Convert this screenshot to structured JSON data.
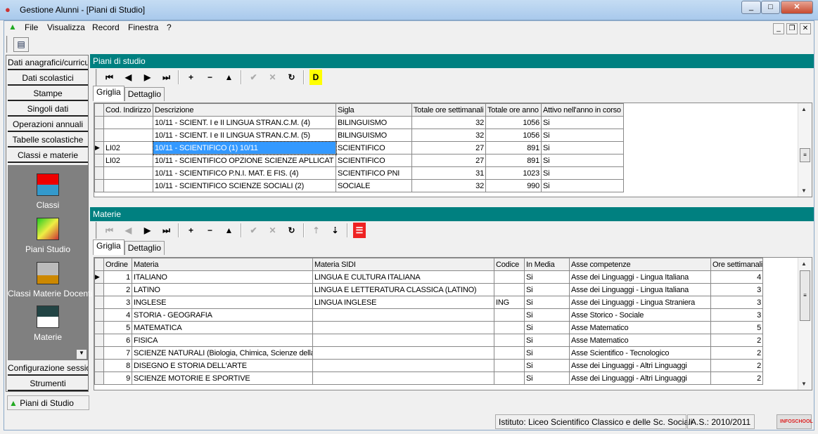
{
  "window": {
    "title": "Gestione Alunni - [Piani di Studio]",
    "controls": [
      "_",
      "□",
      "✕"
    ]
  },
  "menu": [
    "File",
    "Visualizza",
    "Record",
    "Finestra",
    "?"
  ],
  "sidebar": {
    "buttons_top": [
      "Dati anagrafici/curriculum",
      "Dati scolastici",
      "Stampe",
      "Singoli dati",
      "Operazioni annuali",
      "Tabelle scolastiche",
      "Classi e materie"
    ],
    "items": [
      {
        "label": "Classi",
        "icon": "classi-icon"
      },
      {
        "label": "Piani Studio",
        "icon": "piani-studio-icon"
      },
      {
        "label": "Classi Materie Docenti",
        "icon": "teacher-icon"
      },
      {
        "label": "Materie",
        "icon": "materie-icon"
      }
    ],
    "buttons_bottom": [
      "Configurazione sessione",
      "Strumenti"
    ],
    "active_window": "Piani di Studio"
  },
  "panel1": {
    "title": "Piani di studio",
    "tabs": [
      "Griglia",
      "Dettaglio"
    ],
    "columns": [
      "Cod. Indirizzo",
      "Descrizione",
      "Sigla",
      "Totale ore settimanali",
      "Totale ore anno",
      "Attivo nell'anno in corso"
    ],
    "rows": [
      [
        "",
        "10/11 - SCIENT. I e II LINGUA STRAN.C.M. (4)",
        "BILINGUISMO",
        "32",
        "1056",
        "Si"
      ],
      [
        "",
        "10/11 - SCIENT. I e II LINGUA STRAN.C.M. (5)",
        "BILINGUISMO",
        "32",
        "1056",
        "Si"
      ],
      [
        "LI02",
        "10/11 - SCIENTIFICO (1)  10/11",
        "SCIENTIFICO",
        "27",
        "891",
        "Si"
      ],
      [
        "LI02",
        "10/11 - SCIENTIFICO OPZIONE SCIENZE APLLICAT",
        "SCIENTIFICO",
        "27",
        "891",
        "Si"
      ],
      [
        "",
        "10/11 - SCIENTIFICO P.N.I. MAT. E FIS. (4)",
        "SCIENTIFICO PNI",
        "31",
        "1023",
        "Si"
      ],
      [
        "",
        "10/11 - SCIENTIFICO SCIENZE SOCIALI (2)",
        "SOCIALE",
        "32",
        "990",
        "Si"
      ]
    ],
    "current_row": 2
  },
  "panel2": {
    "title": "Materie",
    "tabs": [
      "Griglia",
      "Dettaglio"
    ],
    "columns": [
      "Ordine",
      "Materia",
      "Materia SIDI",
      "Codice",
      "In Media",
      "Asse competenze",
      "Ore settimanali"
    ],
    "rows": [
      [
        "1",
        "ITALIANO",
        "LINGUA E CULTURA ITALIANA",
        "",
        "Si",
        "Asse dei Linguaggi - Lingua Italiana",
        "4"
      ],
      [
        "2",
        "LATINO",
        "LINGUA E LETTERATURA CLASSICA (LATINO)",
        "",
        "Si",
        "Asse dei Linguaggi - Lingua Italiana",
        "3"
      ],
      [
        "3",
        "INGLESE",
        "LINGUA INGLESE",
        "ING",
        "Si",
        "Asse dei Linguaggi - Lingua Straniera",
        "3"
      ],
      [
        "4",
        "STORIA - GEOGRAFIA",
        "",
        "",
        "Si",
        "Asse Storico - Sociale",
        "3"
      ],
      [
        "5",
        "MATEMATICA",
        "",
        "",
        "Si",
        "Asse Matematico",
        "5"
      ],
      [
        "6",
        "FISICA",
        "",
        "",
        "Si",
        "Asse Matematico",
        "2"
      ],
      [
        "7",
        "SCIENZE NATURALI (Biologia, Chimica, Scienze della",
        "",
        "",
        "Si",
        "Asse Scientifico - Tecnologico",
        "2"
      ],
      [
        "8",
        "DISEGNO E STORIA DELL'ARTE",
        "",
        "",
        "Si",
        "Asse dei Linguaggi - Altri Linguaggi",
        "2"
      ],
      [
        "9",
        "SCIENZE MOTORIE E SPORTIVE",
        "",
        "",
        "Si",
        "Asse dei Linguaggi - Altri Linguaggi",
        "2"
      ]
    ],
    "current_row": 0
  },
  "toolbar_glyphs": {
    "first": "⏮",
    "prev": "◀",
    "next": "▶",
    "last": "⏭",
    "add": "+",
    "delete": "−",
    "edit": "▲",
    "confirm": "✔",
    "cancel": "✕",
    "refresh": "↻",
    "detail": "D",
    "move_up": "⇡",
    "move_down": "⇣",
    "list": "☰"
  },
  "status": {
    "istituto": "Istituto: Liceo Scientifico Classico e delle Sc. Sociali",
    "anno": "A.S.: 2010/2011",
    "logo": "INFOSCHOOL"
  },
  "colors": {
    "panel_header": "#008080",
    "selection": "#3399ff",
    "sidebar_gray": "#808080"
  }
}
